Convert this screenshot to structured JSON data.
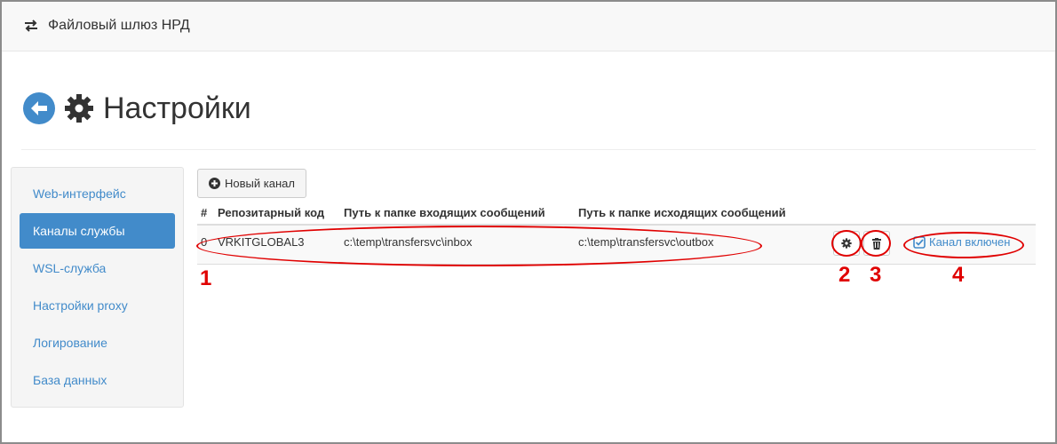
{
  "app": {
    "title": "Файловый шлюз НРД",
    "icon": "exchange-arrows-icon"
  },
  "header": {
    "title": "Настройки",
    "back_icon": "back-arrow-icon",
    "gear_icon": "gear-icon"
  },
  "sidebar": {
    "items": [
      {
        "label": "Web-интерфейс",
        "active": false
      },
      {
        "label": "Каналы службы",
        "active": true
      },
      {
        "label": "WSL-служба",
        "active": false
      },
      {
        "label": "Настройки proxy",
        "active": false
      },
      {
        "label": "Логирование",
        "active": false
      },
      {
        "label": "База данных",
        "active": false
      }
    ]
  },
  "toolbar": {
    "new_channel_label": "Новый канал",
    "new_channel_icon": "plus-circle-icon"
  },
  "table": {
    "columns": [
      "#",
      "Репозитарный код",
      "Путь к папке входящих сообщений",
      "Путь к папке исходящих сообщений"
    ],
    "rows": [
      {
        "index": "0",
        "code": "VRKITGLOBAL3",
        "inbox": "c:\\temp\\transfersvc\\inbox",
        "outbox": "c:\\temp\\transfersvc\\outbox",
        "status": "Канал включен"
      }
    ]
  },
  "annotations": [
    "1",
    "2",
    "3",
    "4"
  ],
  "colors": {
    "accent": "#428bca",
    "annotation": "#e00000"
  }
}
